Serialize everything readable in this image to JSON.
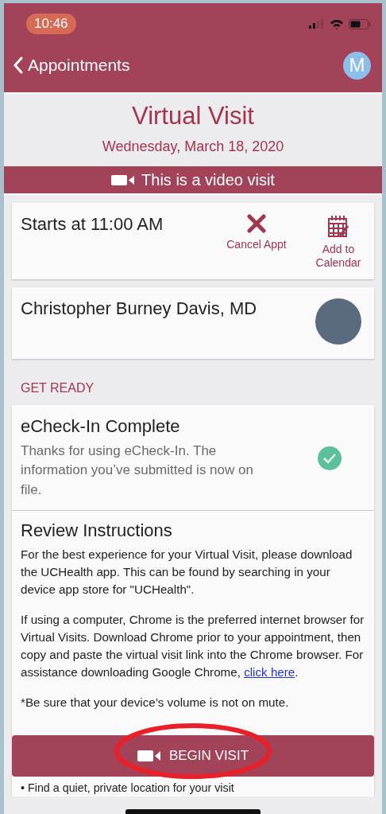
{
  "status_bar": {
    "time": "10:46"
  },
  "nav": {
    "back_label": "Appointments",
    "avatar_initial": "M"
  },
  "header": {
    "title": "Virtual Visit",
    "date": "Wednesday, March 18, 2020"
  },
  "banner": {
    "text": "This is a video visit"
  },
  "time_card": {
    "starts": "Starts at 11:00 AM",
    "actions": [
      {
        "kind": "cancel",
        "label": "Cancel Appt"
      },
      {
        "kind": "calendar",
        "label": "Add to Calendar"
      }
    ]
  },
  "provider_card": {
    "name": "Christopher Burney Davis, MD"
  },
  "section_heading": "GET READY",
  "echeckin": {
    "title": "eCheck-In Complete",
    "text": "Thanks for using eCheck-In. The information you’ve submitted is now on file.",
    "completed": true
  },
  "instructions": {
    "title": "Review Instructions",
    "paragraphs": [
      {
        "text": "For the best experience for your Virtual Visit, please download the UCHealth app. This can be found by searching in your device app store for \"UCHealth\"."
      },
      {
        "text": "If using a computer, Chrome is the preferred internet browser for Virtual Visits. Download Chrome prior to your appointment, then copy and paste the virtual visit link into the Chrome browser. For assistance downloading Google Chrome, ",
        "link": "click here",
        "after": "."
      },
      {
        "text": "*Be sure that your device’s volume is not on mute."
      }
    ],
    "cut_line": "• Find a quiet, private location for your visit"
  },
  "begin_button": {
    "label": "BEGIN VISIT"
  }
}
